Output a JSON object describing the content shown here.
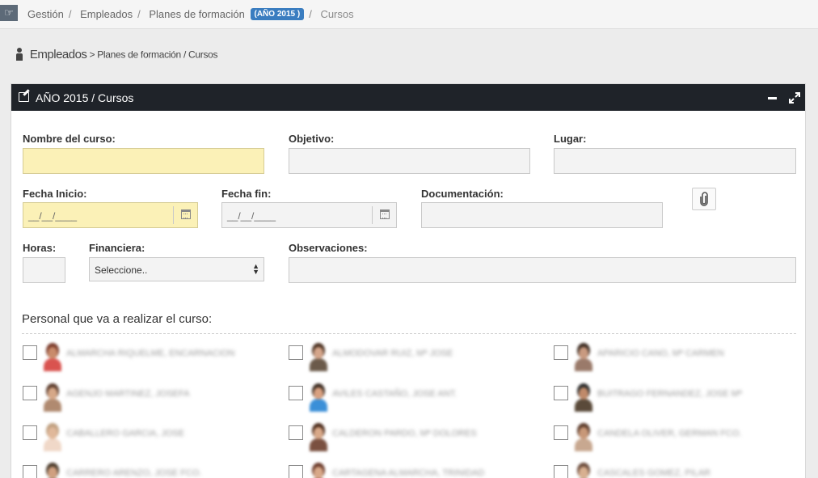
{
  "breadcrumb": {
    "items": [
      "Gestión",
      "Empleados",
      "Planes de formación"
    ],
    "badge": "(AÑO 2015 )",
    "current": "Cursos"
  },
  "page_header": {
    "section": "Empleados",
    "path": "Planes de formación / Cursos"
  },
  "panel": {
    "title": "AÑO 2015 / Cursos"
  },
  "form": {
    "nombre_label": "Nombre del curso:",
    "objetivo_label": "Objetivo:",
    "lugar_label": "Lugar:",
    "fecha_inicio_label": "Fecha Inicio:",
    "fecha_inicio_value": "__/__/____",
    "fecha_fin_label": "Fecha fin:",
    "fecha_fin_value": "__/__/____",
    "documentacion_label": "Documentación:",
    "horas_label": "Horas:",
    "financiera_label": "Financiera:",
    "financiera_selected": "Seleccione..",
    "observaciones_label": "Observaciones:"
  },
  "personal": {
    "title": "Personal que va a realizar el curso:",
    "people": [
      {
        "name": "ALMARCHA RIQUELME, ENCARNACION",
        "shirt": "#d9534f",
        "skin": "#c98b6b",
        "hair": "#7a3a2a"
      },
      {
        "name": "ALMODOVAR RUIZ, Mª JOSE",
        "shirt": "#6b5a4a",
        "skin": "#d4a58a",
        "hair": "#4a3020"
      },
      {
        "name": "APARICIO CANO, Mª CARMEN",
        "shirt": "#9a7a6a",
        "skin": "#c99a80",
        "hair": "#3a2a20"
      },
      {
        "name": "AGENJO MARTINEZ, JOSEFA",
        "shirt": "#b08a70",
        "skin": "#d6a888",
        "hair": "#5a3a2a"
      },
      {
        "name": "AVILES CASTAÑO, JOSE ANT.",
        "shirt": "#3a8fd8",
        "skin": "#d8a080",
        "hair": "#3a2a20"
      },
      {
        "name": "BUITRAGO FERNANDEZ, JOSE Mª",
        "shirt": "#5a4a3a",
        "skin": "#c08a6a",
        "hair": "#2a2a2a"
      },
      {
        "name": "CABALLERO GARCIA, JOSE",
        "shirt": "#f0d8c8",
        "skin": "#e0b89a",
        "hair": "#c0a080"
      },
      {
        "name": "CALDERON PARDO, Mª DOLORES",
        "shirt": "#7a5040",
        "skin": "#d8a888",
        "hair": "#4a2a1a"
      },
      {
        "name": "CANDELA OLIVER, GERMAN FCO.",
        "shirt": "#c8a890",
        "skin": "#c89878",
        "hair": "#5a3a2a"
      },
      {
        "name": "CARRERO ARENZO, JOSE FCO.",
        "shirt": "#8a7a6a",
        "skin": "#d0a080",
        "hair": "#4a3a2a"
      },
      {
        "name": "CARTAGENA ALMARCHA, TRINIDAD",
        "shirt": "#9a5a4a",
        "skin": "#d8a888",
        "hair": "#6a3a2a"
      },
      {
        "name": "CASCALES GOMEZ, PILAR",
        "shirt": "#b0a090",
        "skin": "#d8b090",
        "hair": "#6a4a3a"
      }
    ]
  }
}
